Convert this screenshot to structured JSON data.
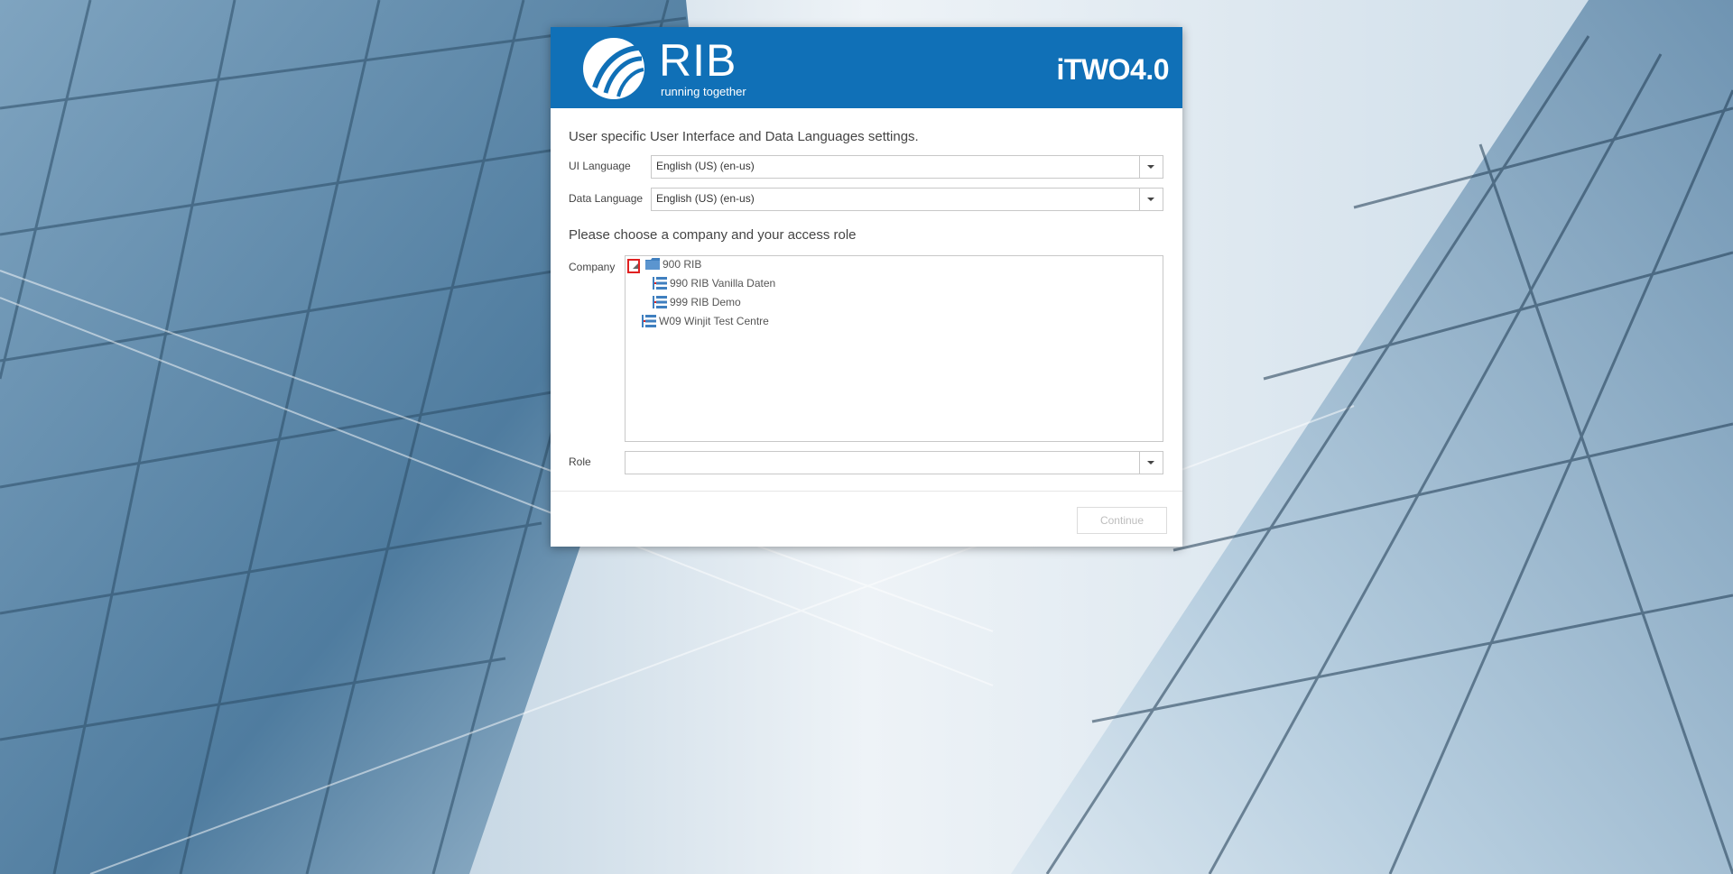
{
  "header": {
    "brand_name": "RIB",
    "brand_tagline": "running together",
    "product_name": "iTWO4.0"
  },
  "languages": {
    "section_title": "User specific User Interface and Data Languages settings.",
    "ui_language": {
      "label": "UI Language",
      "value": "English (US) (en-us)"
    },
    "data_language": {
      "label": "Data Language",
      "value": "English (US) (en-us)"
    }
  },
  "access": {
    "section_title": "Please choose a company and your access role",
    "company_label": "Company",
    "companies": [
      {
        "label": "900 RIB",
        "icon": "folder-icon",
        "level": 0,
        "expanded": true
      },
      {
        "label": "990 RIB Vanilla Daten",
        "icon": "hierarchy-icon",
        "level": 1
      },
      {
        "label": "999 RIB Demo",
        "icon": "hierarchy-icon",
        "level": 1
      },
      {
        "label": "W09 Winjit Test Centre",
        "icon": "hierarchy-icon",
        "level": 0
      }
    ],
    "role": {
      "label": "Role",
      "value": ""
    }
  },
  "footer": {
    "continue_label": "Continue",
    "continue_enabled": false
  },
  "colors": {
    "header_blue": "#1070b7",
    "icon_blue": "#3f7fbf",
    "expander_red": "#e02020"
  }
}
